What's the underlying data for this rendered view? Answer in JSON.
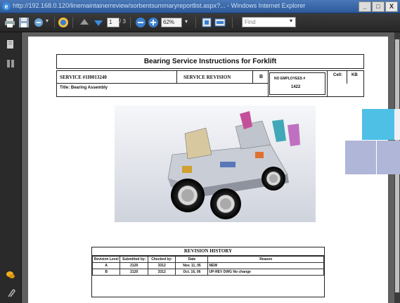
{
  "window": {
    "title": "http://192.168.0.120/linemaintainerreview/sorbentsummaryreportlist.aspx?... - Windows Internet Explorer",
    "minimize": "_",
    "maximize": "□",
    "close": "X"
  },
  "toolbar": {
    "page_current": "1",
    "page_total": "/ 3",
    "zoom": "62%",
    "find_placeholder": "Find"
  },
  "document": {
    "title": "Bearing Service Instructions for Forklift",
    "service_label": "SERVICE #1I0013240",
    "service_revision_label": "SERVICE REVISION",
    "service_revision_value": "B",
    "title_field": "Title: Bearing Assembly",
    "employees_label": "NO EMPLOYEES #",
    "employees_value": "1422",
    "cell_a": "Cell:",
    "cell_b": "KB"
  },
  "revision_history": {
    "caption": "REVISION HISTORY",
    "headers": [
      "Revision Level",
      "Submitted by:",
      "Checked by:",
      "Date",
      "Reason"
    ],
    "rows": [
      [
        "A",
        "2120",
        "3312",
        "Nov. 11, 05",
        "NEW"
      ],
      [
        "B",
        "2120",
        "3312",
        "Oct. 16, 06",
        "UP-REV DWG No change"
      ]
    ]
  },
  "colors": {
    "tile_cyan": "#4ec0e6",
    "tile_lavender": "#b0b6d8",
    "tile_white": "#eef0f6"
  }
}
